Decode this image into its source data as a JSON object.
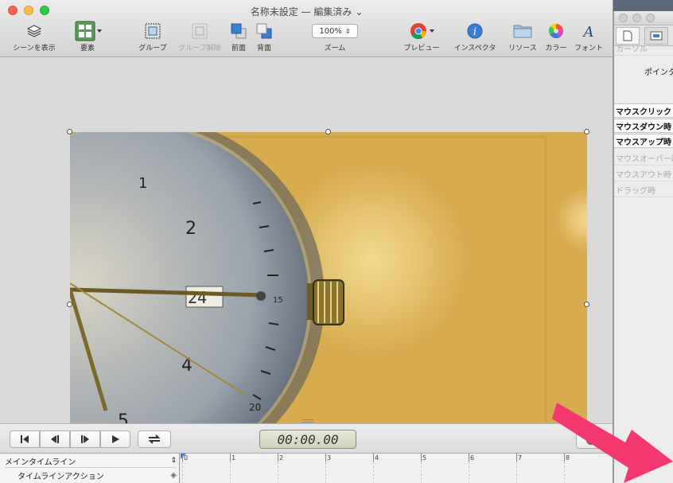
{
  "window": {
    "title": "名称未設定 — 編集済み",
    "toolbar": {
      "show_scene": "シーンを表示",
      "elements": "要素",
      "group": "グループ",
      "ungroup": "グループ解除",
      "front": "前面",
      "back": "背面",
      "zoom_value": "100%",
      "zoom_label": "ズーム",
      "preview": "プレビュー",
      "inspector": "インスペクタ",
      "resources": "リソース",
      "colors": "カラー",
      "fonts": "フォント"
    }
  },
  "transport": {
    "timecode": "00:00.00"
  },
  "timeline": {
    "main": "メインタイムライン",
    "action": "タイムラインアクション",
    "ruler": [
      "0",
      "1",
      "2",
      "3",
      "4",
      "5",
      "6",
      "7",
      "8"
    ]
  },
  "inspector": {
    "cursor": "カーソル",
    "pointer": "ポインタ",
    "mouse_click": "マウスクリック",
    "mouse_down": "マウスダウン時",
    "mouse_up": "マウスアップ時",
    "mouse_over": "マウスオーバー時",
    "mouse_out": "マウスアウト時",
    "drag": "ドラッグ時"
  },
  "colors": {
    "accent_arrow": "#f2386f",
    "photo_bg": "#dcb358"
  }
}
